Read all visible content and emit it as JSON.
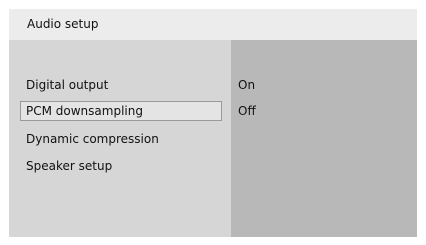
{
  "header": {
    "title": "Audio setup"
  },
  "menu": {
    "items": [
      {
        "label": "Digital output",
        "value": "On",
        "selected": false
      },
      {
        "label": "PCM downsampling",
        "value": "Off",
        "selected": true
      },
      {
        "label": "Dynamic compression",
        "value": "",
        "selected": false
      },
      {
        "label": "Speaker setup",
        "value": "",
        "selected": false
      }
    ]
  },
  "colors": {
    "header_bg": "#ececec",
    "menu_bg": "#d6d6d6",
    "value_panel_bg": "#b8b8b8",
    "selected_bg": "#e4e4e4",
    "selected_border": "#9a9a9a"
  }
}
